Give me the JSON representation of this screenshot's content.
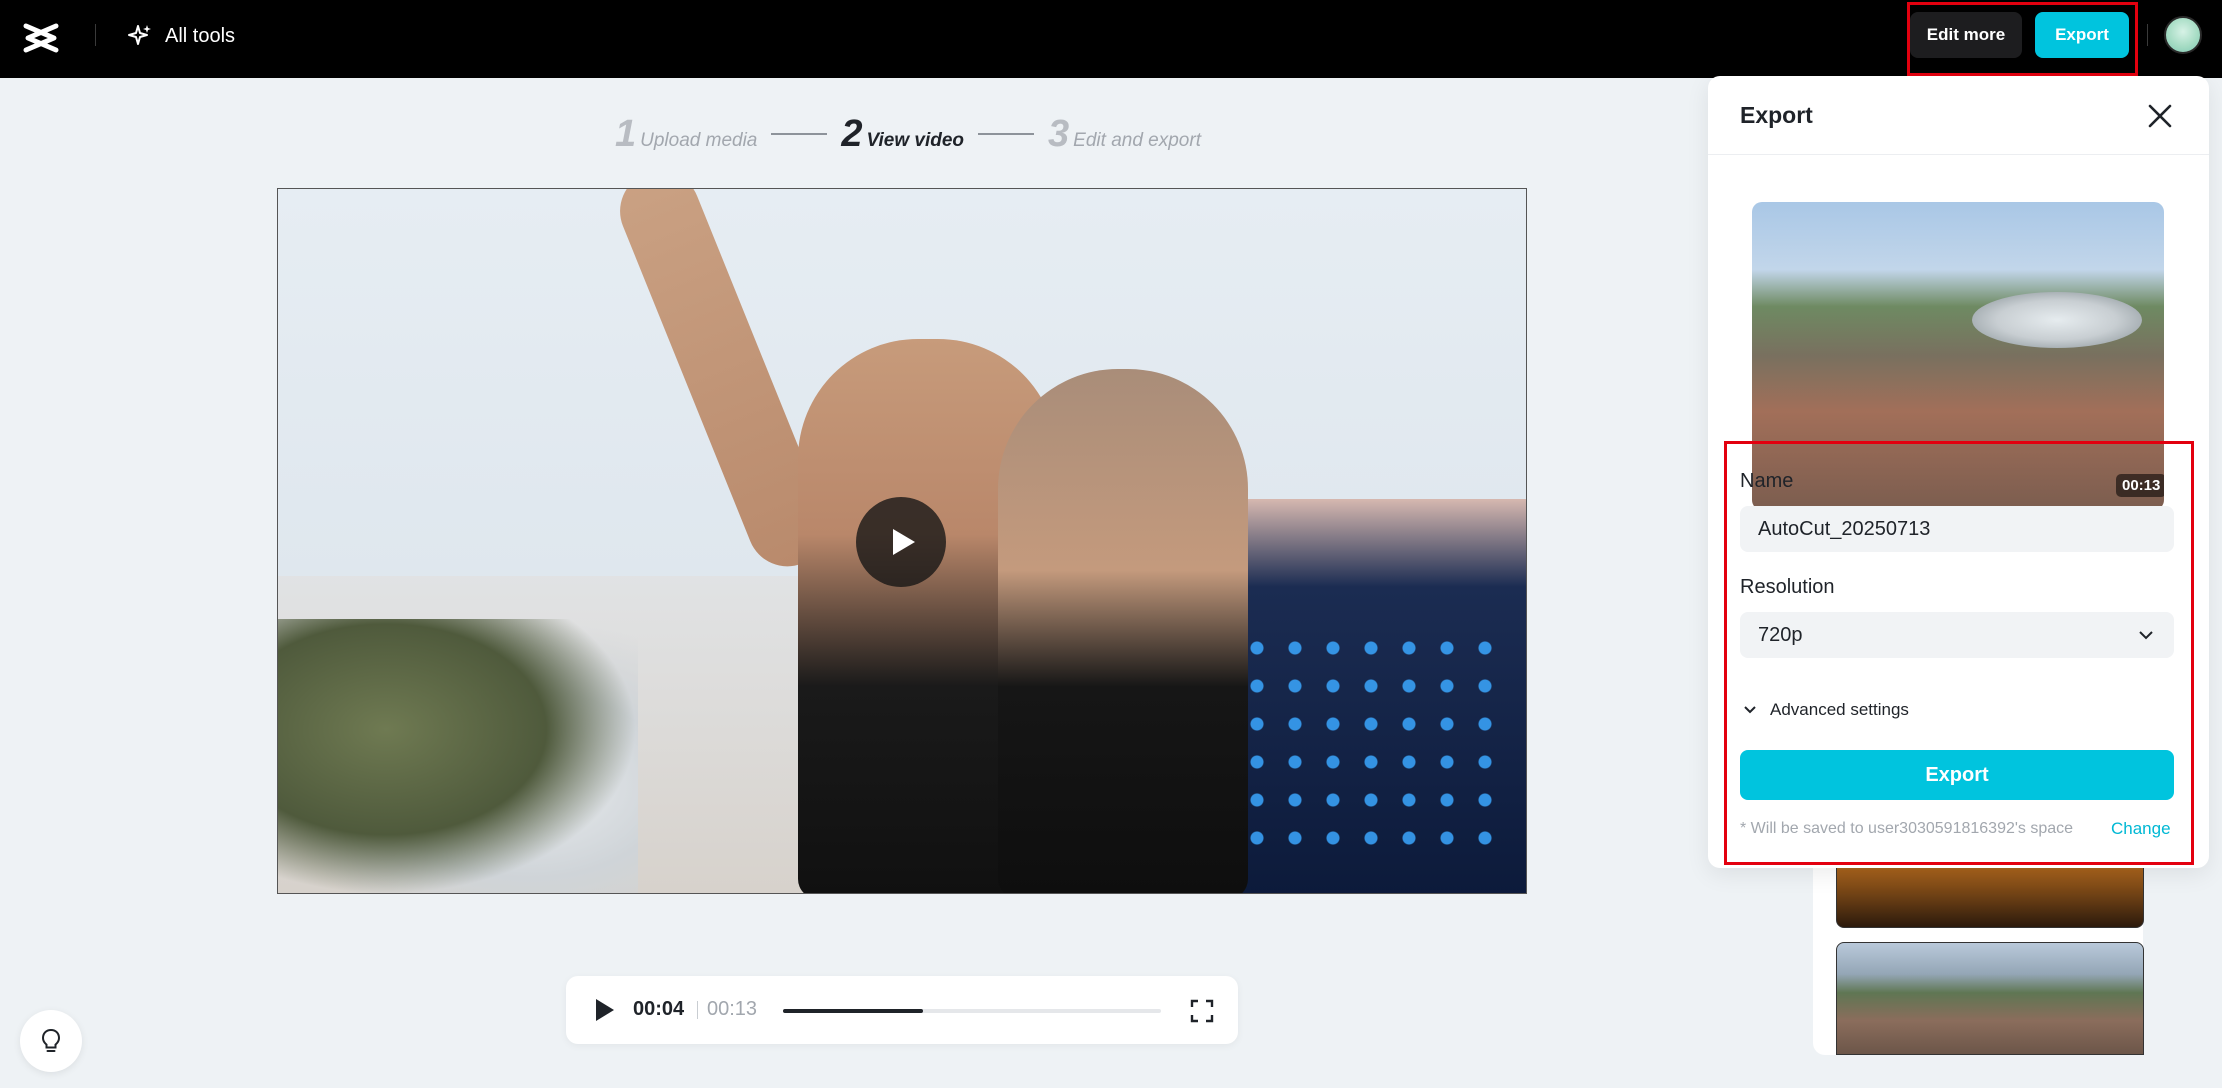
{
  "header": {
    "all_tools_label": "All tools",
    "edit_more_label": "Edit more",
    "export_label": "Export"
  },
  "steps": [
    {
      "num": "1",
      "label": "Upload media",
      "active": false
    },
    {
      "num": "2",
      "label": "View video",
      "active": true
    },
    {
      "num": "3",
      "label": "Edit and export",
      "active": false
    }
  ],
  "player": {
    "current_time": "00:04",
    "total_time": "00:13",
    "progress_percent": 37
  },
  "export_panel": {
    "title": "Export",
    "thumbnail_duration": "00:13",
    "name_label": "Name",
    "name_value": "AutoCut_20250713",
    "resolution_label": "Resolution",
    "resolution_value": "720p",
    "advanced_label": "Advanced settings",
    "export_button_label": "Export",
    "save_note": "* Will be saved to user3030591816392's space",
    "change_label": "Change"
  },
  "colors": {
    "accent": "#00c4de",
    "highlight": "#e3000f",
    "topbar": "#000000"
  }
}
